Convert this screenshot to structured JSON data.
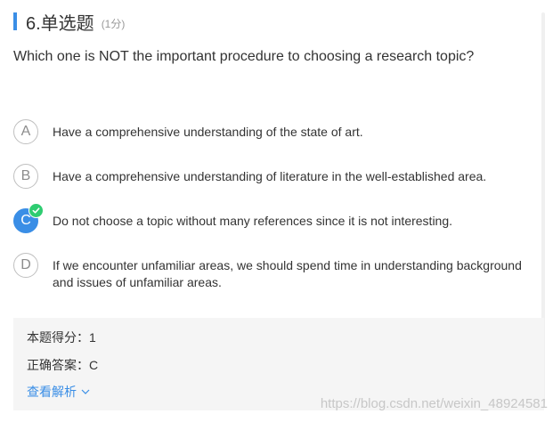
{
  "question": {
    "title": "6.单选题",
    "score": "(1分)",
    "text": "Which one is NOT the important procedure to choosing a research topic?"
  },
  "options": [
    {
      "letter": "A",
      "text": "Have a comprehensive understanding of the state of art."
    },
    {
      "letter": "B",
      "text": "Have a comprehensive understanding of literature in the well-established area."
    },
    {
      "letter": "C",
      "text": "Do not choose a topic without many references since it is not interesting."
    },
    {
      "letter": "D",
      "text": "If we encounter unfamiliar areas, we should spend time in understanding background and issues of unfamiliar areas."
    }
  ],
  "selected_option": "C",
  "analysis": {
    "score_label": "本题得分：",
    "score_value": "1",
    "answer_label": "正确答案：",
    "answer_value": "C",
    "view_label": "查看解析"
  },
  "watermark": "https://blog.csdn.net/weixin_48924581",
  "colors": {
    "accent": "#3a8ee6",
    "correct_badge": "#2ecc71"
  }
}
